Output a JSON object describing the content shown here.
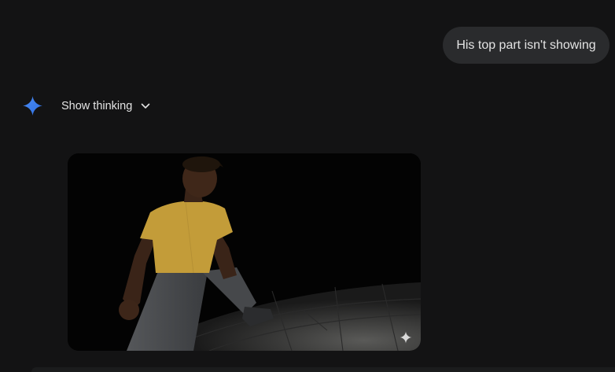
{
  "user_message": {
    "text": "His top part isn't showing"
  },
  "response": {
    "show_thinking_label": "Show thinking",
    "avatar_icon": "gemini-sparkle-icon",
    "expand_icon": "chevron-down-icon"
  },
  "generated_image": {
    "overlay_icon": "sparkle-icon"
  },
  "colors": {
    "background": "#131314",
    "bubble": "#2a2b2d",
    "text": "#e3e3e3",
    "accent_blue": "#4a8cf7"
  }
}
